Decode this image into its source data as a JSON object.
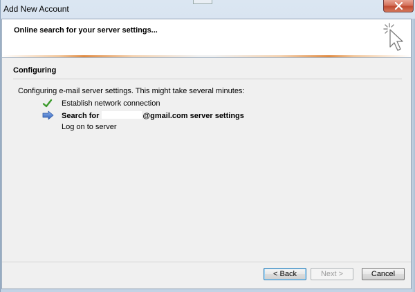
{
  "window": {
    "title": "Add New Account"
  },
  "header": {
    "title": "Online search for your server settings...",
    "icon": "wizard-cursor-icon"
  },
  "section": {
    "title": "Configuring",
    "intro": "Configuring e-mail server settings. This might take several minutes:"
  },
  "steps": [
    {
      "icon": "checkmark-icon",
      "label": "Establish network connection",
      "status": "done"
    },
    {
      "icon": "arrow-right-icon",
      "label_prefix": "Search for",
      "label_suffix": "@gmail.com server settings",
      "status": "current"
    },
    {
      "icon": "",
      "label": "Log on to server",
      "status": "pending"
    }
  ],
  "buttons": {
    "back": "< Back",
    "next": "Next >",
    "cancel": "Cancel"
  },
  "colors": {
    "check": "#3a9a2a",
    "arrow": "#3f6fc6",
    "accent_orange": "#e08b42"
  }
}
